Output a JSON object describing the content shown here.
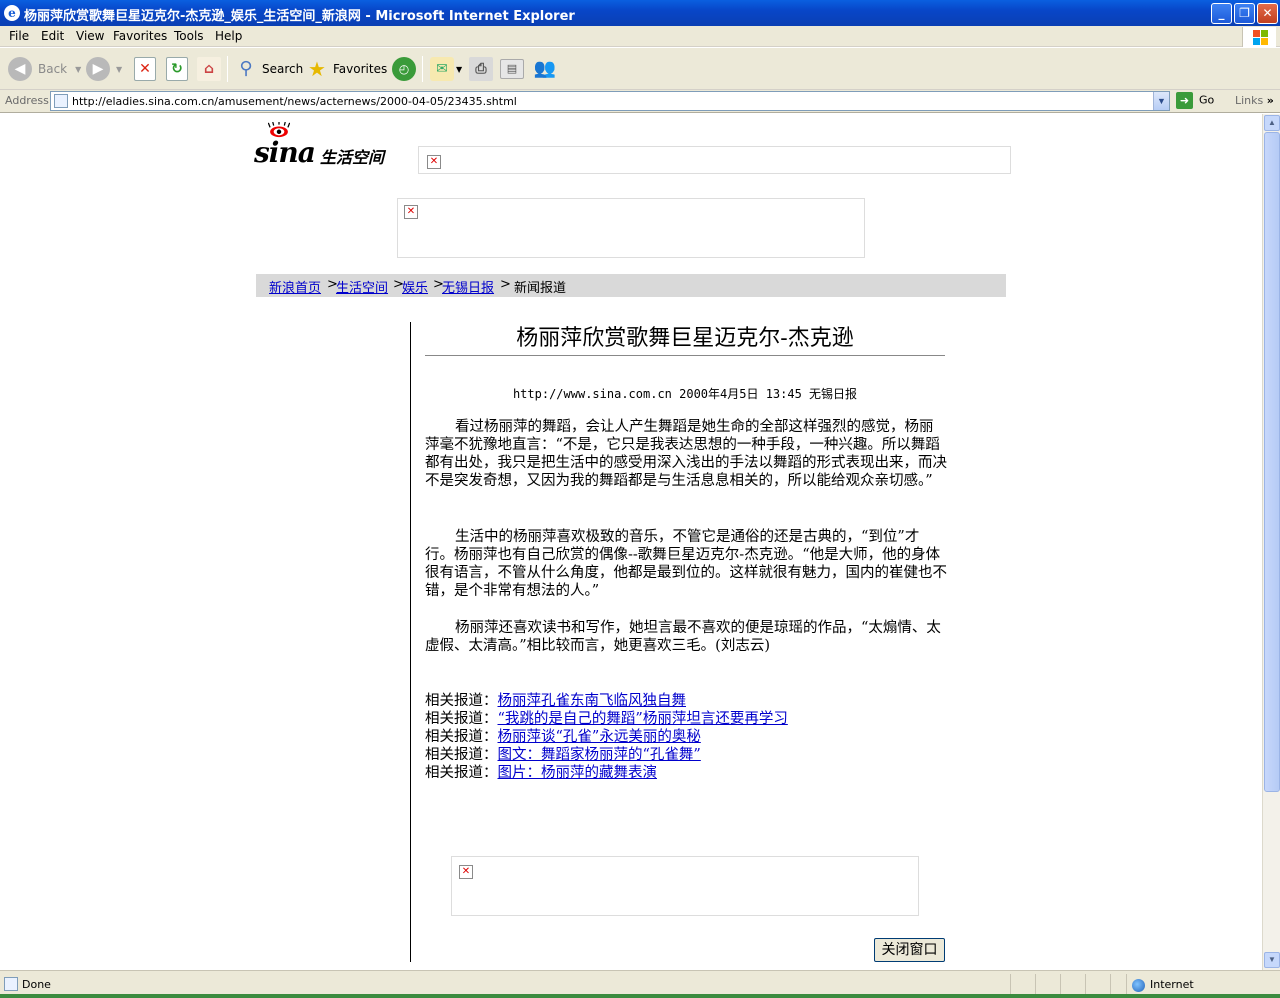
{
  "window": {
    "title": "杨丽萍欣赏歌舞巨星迈克尔-杰克逊_娱乐_生活空间_新浪网 - Microsoft Internet Explorer",
    "minimize": "_",
    "maximize": "❐",
    "close": "✕"
  },
  "menu": {
    "file": "File",
    "edit": "Edit",
    "view": "View",
    "favorites": "Favorites",
    "tools": "Tools",
    "help": "Help"
  },
  "toolbar": {
    "back": "Back",
    "search": "Search",
    "favorites": "Favorites"
  },
  "address": {
    "label": "Address",
    "url": "http://eladies.sina.com.cn/amusement/news/acternews/2000-04-05/23435.shtml",
    "go": "Go",
    "links": "Links"
  },
  "page": {
    "logo_word": "sina",
    "logo_sub": "生活空间",
    "breadcrumb": {
      "home": "新浪首页",
      "life": "生活空间",
      "ent": "娱乐",
      "paper": "无锡日报",
      "sep": ">",
      "current": "新闻报道"
    },
    "title": "杨丽萍欣赏歌舞巨星迈克尔-杰克逊",
    "source": "http://www.sina.com.cn 2000年4月5日 13:45 无锡日报",
    "paragraphs": [
      "看过杨丽萍的舞蹈，会让人产生舞蹈是她生命的全部这样强烈的感觉，杨丽萍毫不犹豫地直言：“不是，它只是我表达思想的一种手段，一种兴趣。所以舞蹈都有出处，我只是把生活中的感受用深入浅出的手法以舞蹈的形式表现出来，而决不是突发奇想，又因为我的舞蹈都是与生活息息相关的，所以能给观众亲切感。”",
      "生活中的杨丽萍喜欢极致的音乐，不管它是通俗的还是古典的，“到位”才行。杨丽萍也有自己欣赏的偶像--歌舞巨星迈克尔-杰克逊。“他是大师，他的身体很有语言，不管从什么角度，他都是最到位的。这样就很有魅力，国内的崔健也不错，是个非常有想法的人。”",
      "杨丽萍还喜欢读书和写作，她坦言最不喜欢的便是琼瑶的作品，“太煽情、太虚假、太清高。”相比较而言，她更喜欢三毛。(刘志云)"
    ],
    "related_prefix": "相关报道：",
    "related": [
      "杨丽萍孔雀东南飞临风独自舞",
      "“我跳的是自己的舞蹈”杨丽萍坦言还要再学习",
      "杨丽萍谈“孔雀”永远美丽的奥秘",
      "图文：舞蹈家杨丽萍的“孔雀舞”",
      "图片：杨丽萍的藏舞表演"
    ],
    "close_button": "关闭窗口"
  },
  "status": {
    "text": "Done",
    "zone": "Internet"
  },
  "colors": {
    "titlebar": "#0a4fd0",
    "chrome": "#ece9d8",
    "link": "#0000cc",
    "breadcrumb_bg": "#d9d9d9"
  }
}
